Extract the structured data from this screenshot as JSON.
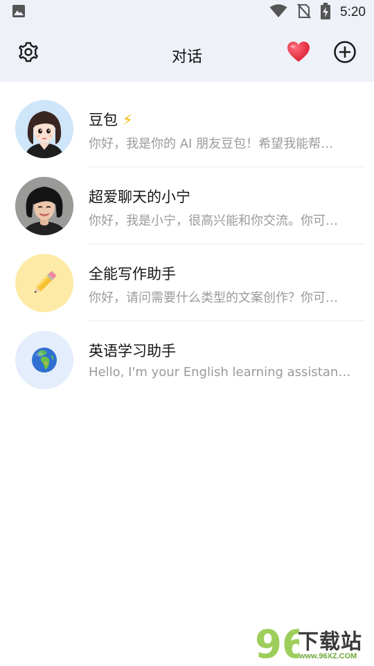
{
  "status_bar": {
    "time": "5:20",
    "icons": [
      "image-notification-icon",
      "wifi-icon",
      "no-sim-icon",
      "battery-charging-icon"
    ]
  },
  "app_bar": {
    "title": "对话",
    "left_icon": "settings-gear-icon",
    "right_icons": [
      "heart-icon",
      "add-circle-icon"
    ],
    "heart_color": "#e8283c"
  },
  "chats": [
    {
      "name": "豆包",
      "badge": "⚡",
      "preview": "你好，我是你的 AI 朋友豆包！希望我能帮…",
      "avatar": "cartoon-girl-avatar"
    },
    {
      "name": "超爱聊天的小宁",
      "badge": "",
      "preview": "你好，我是小宁，很高兴能和你交流。你可…",
      "avatar": "short-hair-woman-avatar"
    },
    {
      "name": "全能写作助手",
      "badge": "",
      "preview": "你好，请问需要什么类型的文案创作？你可…",
      "avatar": "pencil-avatar"
    },
    {
      "name": "英语学习助手",
      "badge": "",
      "preview": "Hello, I'm your English learning assistant. L…",
      "avatar": "globe-avatar"
    }
  ],
  "watermark": {
    "digits": "96",
    "text": "下载站",
    "url": "www.96XZ.COM"
  }
}
